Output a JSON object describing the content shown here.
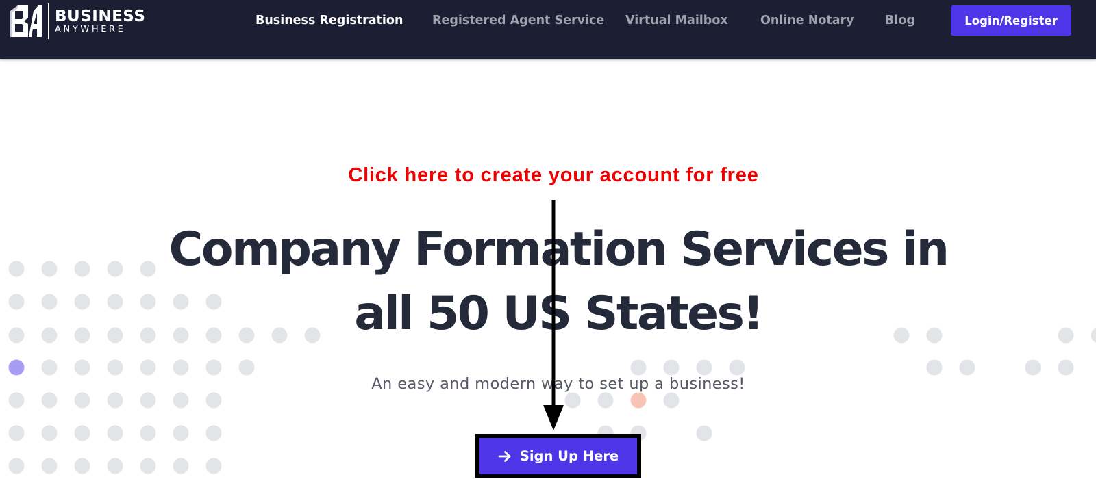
{
  "brand": {
    "name_line1": "BUSINESS",
    "name_line2": "ANYWHERE",
    "logo_icon": "ba-monogram-icon"
  },
  "nav": {
    "items": [
      {
        "label": "Business Registration",
        "active": true
      },
      {
        "label": "Registered Agent Service",
        "active": false
      },
      {
        "label": "Virtual Mailbox",
        "active": false
      },
      {
        "label": "Online Notary",
        "active": false
      },
      {
        "label": "Blog",
        "active": false
      }
    ],
    "login_label": "Login/Register"
  },
  "hero": {
    "annotation": "Click here to create your account for free",
    "title_line1": "Company Formation Services in",
    "title_line2": "all 50 US States!",
    "subtitle": "An easy and modern way to set up a business!",
    "cta_label": "Sign Up Here",
    "cta_icon": "arrow-right-icon"
  },
  "colors": {
    "nav_bg": "#1c1f33",
    "accent": "#4f35e8",
    "annotation": "#ee0000",
    "title": "#252a3b",
    "dot": "#e3e4e8",
    "dot_purple": "#a79cf4",
    "dot_orange": "#f7c4b4"
  }
}
